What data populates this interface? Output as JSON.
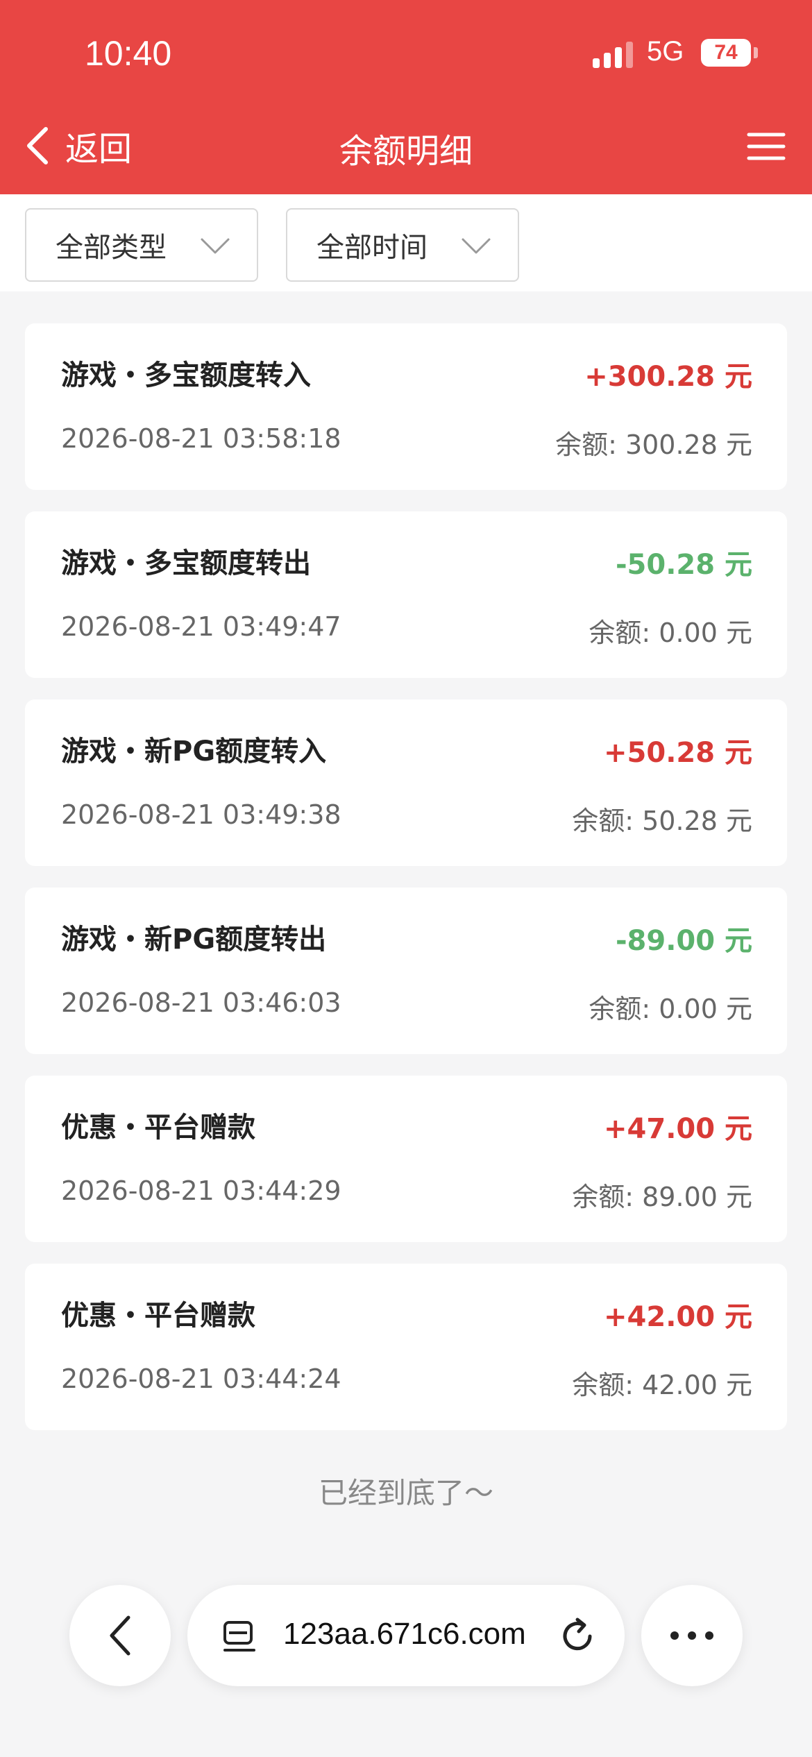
{
  "status": {
    "time": "10:40",
    "network": "5G",
    "battery": "74"
  },
  "nav": {
    "back_label": "返回",
    "title": "余额明细"
  },
  "filters": [
    {
      "label": "全部类型"
    },
    {
      "label": "全部时间"
    }
  ],
  "records": [
    {
      "title": "游戏・多宝额度转入",
      "amount": "+300.28 元",
      "sign": "positive",
      "time": "2026-08-21 03:58:18",
      "balance": "余额: 300.28 元"
    },
    {
      "title": "游戏・多宝额度转出",
      "amount": "-50.28 元",
      "sign": "negative",
      "time": "2026-08-21 03:49:47",
      "balance": "余额: 0.00 元"
    },
    {
      "title": "游戏・新PG额度转入",
      "amount": "+50.28 元",
      "sign": "positive",
      "time": "2026-08-21 03:49:38",
      "balance": "余额: 50.28 元"
    },
    {
      "title": "游戏・新PG额度转出",
      "amount": "-89.00 元",
      "sign": "negative",
      "time": "2026-08-21 03:46:03",
      "balance": "余额: 0.00 元"
    },
    {
      "title": "优惠・平台赠款",
      "amount": "+47.00 元",
      "sign": "positive",
      "time": "2026-08-21 03:44:29",
      "balance": "余额: 89.00 元"
    },
    {
      "title": "优惠・平台赠款",
      "amount": "+42.00 元",
      "sign": "positive",
      "time": "2026-08-21 03:44:24",
      "balance": "余额: 42.00 元"
    }
  ],
  "end_tip": "已经到底了～",
  "browser": {
    "url": "123aa.671c6.com"
  },
  "colors": {
    "header": "#e84644",
    "positive": "#d83a36",
    "negative": "#5bb26c"
  }
}
